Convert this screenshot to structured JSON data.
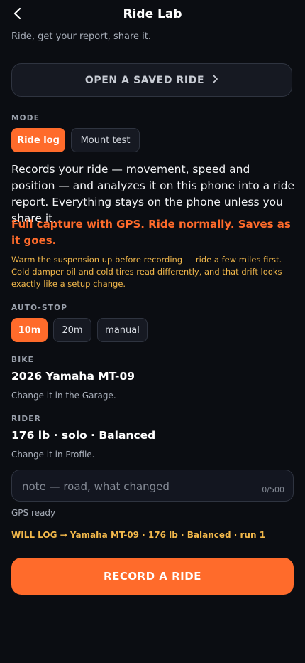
{
  "header": {
    "title": "Ride Lab",
    "subtitle": "Ride, get your report, share it."
  },
  "saved_ride": {
    "label": "OPEN A SAVED RIDE"
  },
  "mode": {
    "label": "MODE",
    "options": [
      {
        "label": "Ride log",
        "active": true
      },
      {
        "label": "Mount test",
        "active": false
      }
    ]
  },
  "description": "Records your ride — movement, speed and position — and analyzes it on this phone into a ride report. Everything stays on the phone unless you share it.",
  "capture_note": "Full capture with GPS. Ride normally. Saves as it goes.",
  "warm_note": "Warm the suspension up before recording — ride a few miles first. Cold damper oil and cold tires read differently, and that drift looks exactly like a setup change.",
  "auto_stop": {
    "label": "AUTO-STOP",
    "options": [
      {
        "label": "10m",
        "active": true
      },
      {
        "label": "20m",
        "active": false
      },
      {
        "label": "manual",
        "active": false
      }
    ]
  },
  "bike": {
    "label": "BIKE",
    "value": "2026 Yamaha MT-09",
    "hint": "Change it in the Garage."
  },
  "rider": {
    "label": "RIDER",
    "value": "176 lb · solo · Balanced",
    "hint": "Change it in Profile."
  },
  "note": {
    "placeholder": "note — road, what changed",
    "value": "",
    "counter": "0/500"
  },
  "gps_status": "GPS ready",
  "will_log": "WILL LOG → Yamaha MT-09 · 176 lb · Balanced · run 1",
  "record_button": "RECORD A RIDE",
  "colors": {
    "accent": "#ff6b2b",
    "warning": "#f2b84b",
    "background": "#0b0d12",
    "surface": "#161922"
  }
}
